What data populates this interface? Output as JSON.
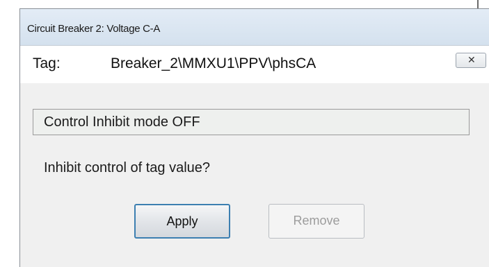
{
  "dialog": {
    "title": "Circuit Breaker 2: Voltage C-A",
    "tag_label": "Tag:",
    "tag_value": "Breaker_2\\MMXU1\\PPV\\phsCA",
    "close_icon": "close-icon"
  },
  "status": {
    "text": "Control Inhibit mode OFF"
  },
  "prompt": {
    "question": "Inhibit control of tag value?"
  },
  "buttons": {
    "apply_label": "Apply",
    "remove_label": "Remove",
    "remove_enabled": false
  },
  "colors": {
    "titlebar": "#d4e1ee",
    "apply_border": "#3c7fb1",
    "disabled_text": "#9c9c9c"
  }
}
